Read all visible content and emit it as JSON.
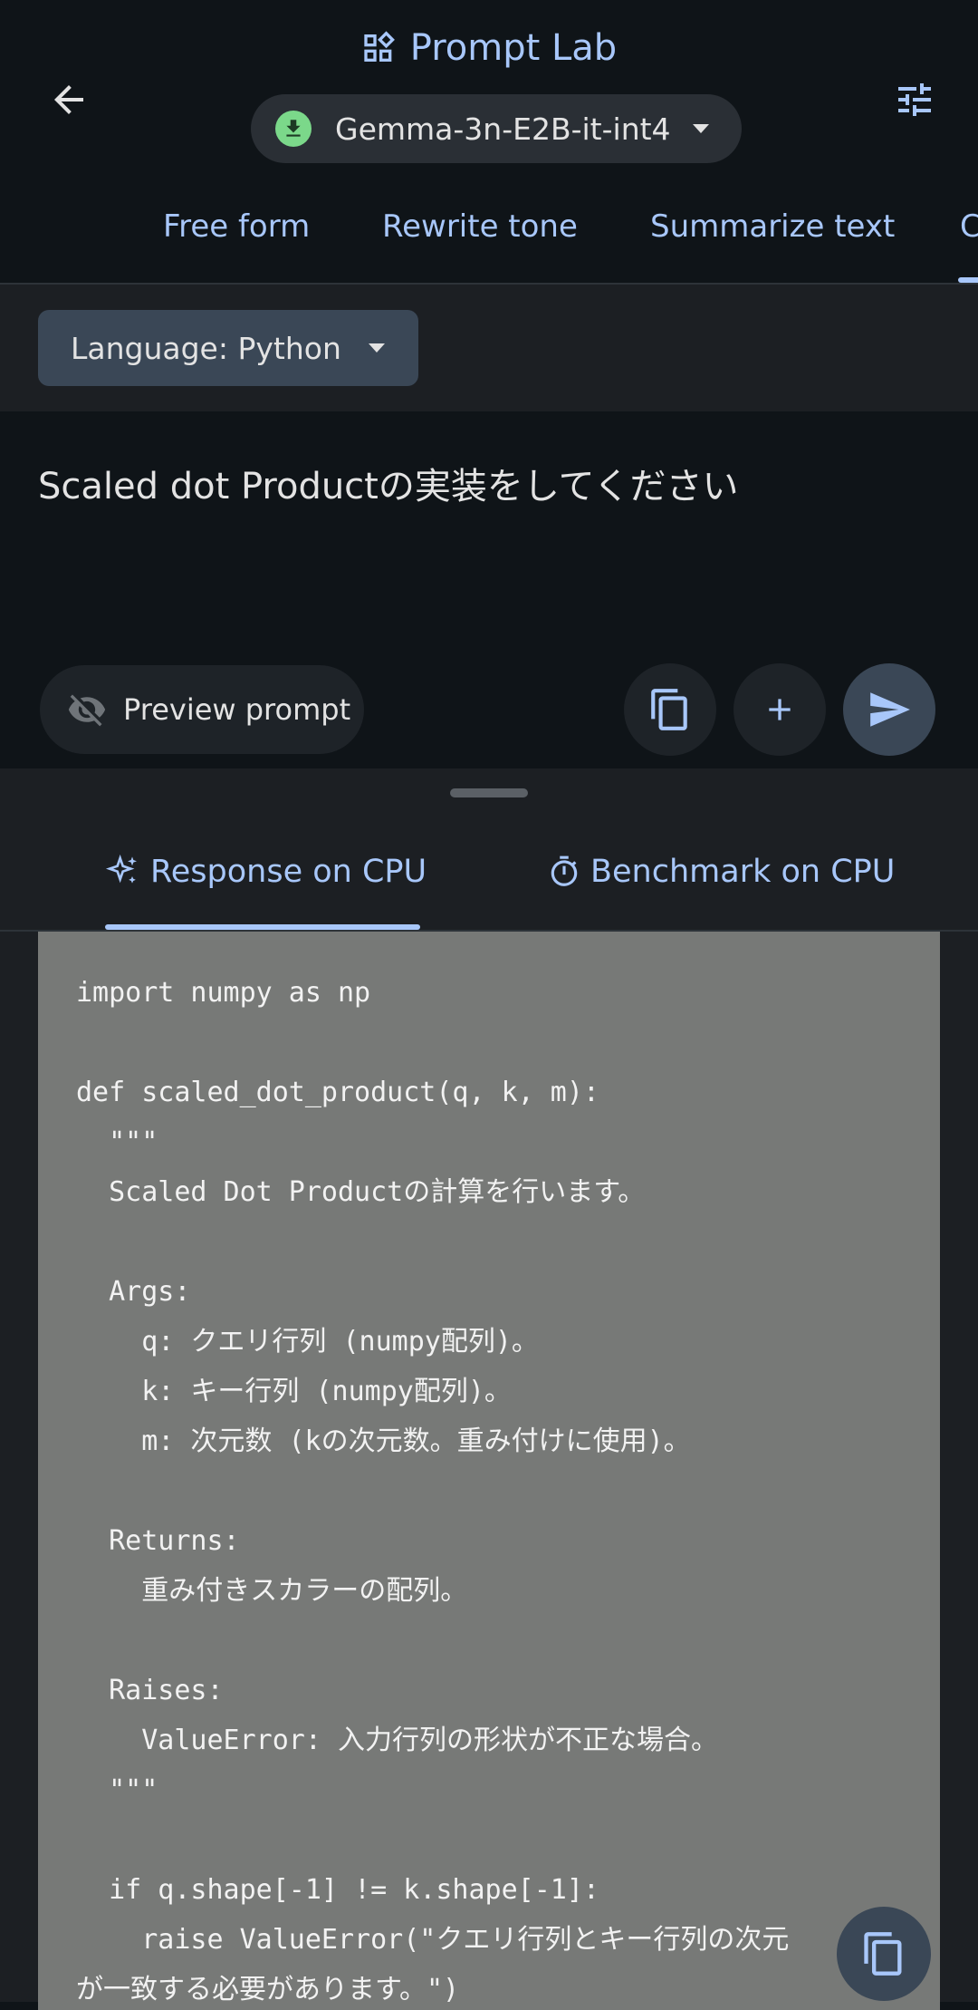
{
  "header": {
    "title": "Prompt Lab",
    "model_name": "Gemma-3n-E2B-it-int4"
  },
  "tabs": [
    {
      "label": "Free form"
    },
    {
      "label": "Rewrite tone"
    },
    {
      "label": "Summarize text"
    },
    {
      "label": "C"
    }
  ],
  "language": {
    "label": "Language: Python"
  },
  "prompt": {
    "text": "Scaled dot Productの実装をしてください",
    "preview_label": "Preview prompt"
  },
  "response_tabs": {
    "response_label": "Response on CPU",
    "benchmark_label": "Benchmark on CPU"
  },
  "code": {
    "text": "import numpy as np\n\ndef scaled_dot_product(q, k, m):\n  \"\"\"\n  Scaled Dot Productの計算を行います。\n\n  Args:\n    q: クエリ行列 (numpy配列)。\n    k: キー行列 (numpy配列)。\n    m: 次元数 (kの次元数。重み付けに使用)。\n\n  Returns:\n    重み付きスカラーの配列。\n\n  Raises:\n    ValueError: 入力行列の形状が不正な場合。\n  \"\"\"\n\n  if q.shape[-1] != k.shape[-1]:\n    raise ValueError(\"クエリ行列とキー行列の次元\nが一致する必要があります。\")"
  },
  "colors": {
    "accent": "#a8c7fa",
    "background": "#0f1418",
    "code_background": "#777977",
    "download_badge": "#7bd88a"
  }
}
